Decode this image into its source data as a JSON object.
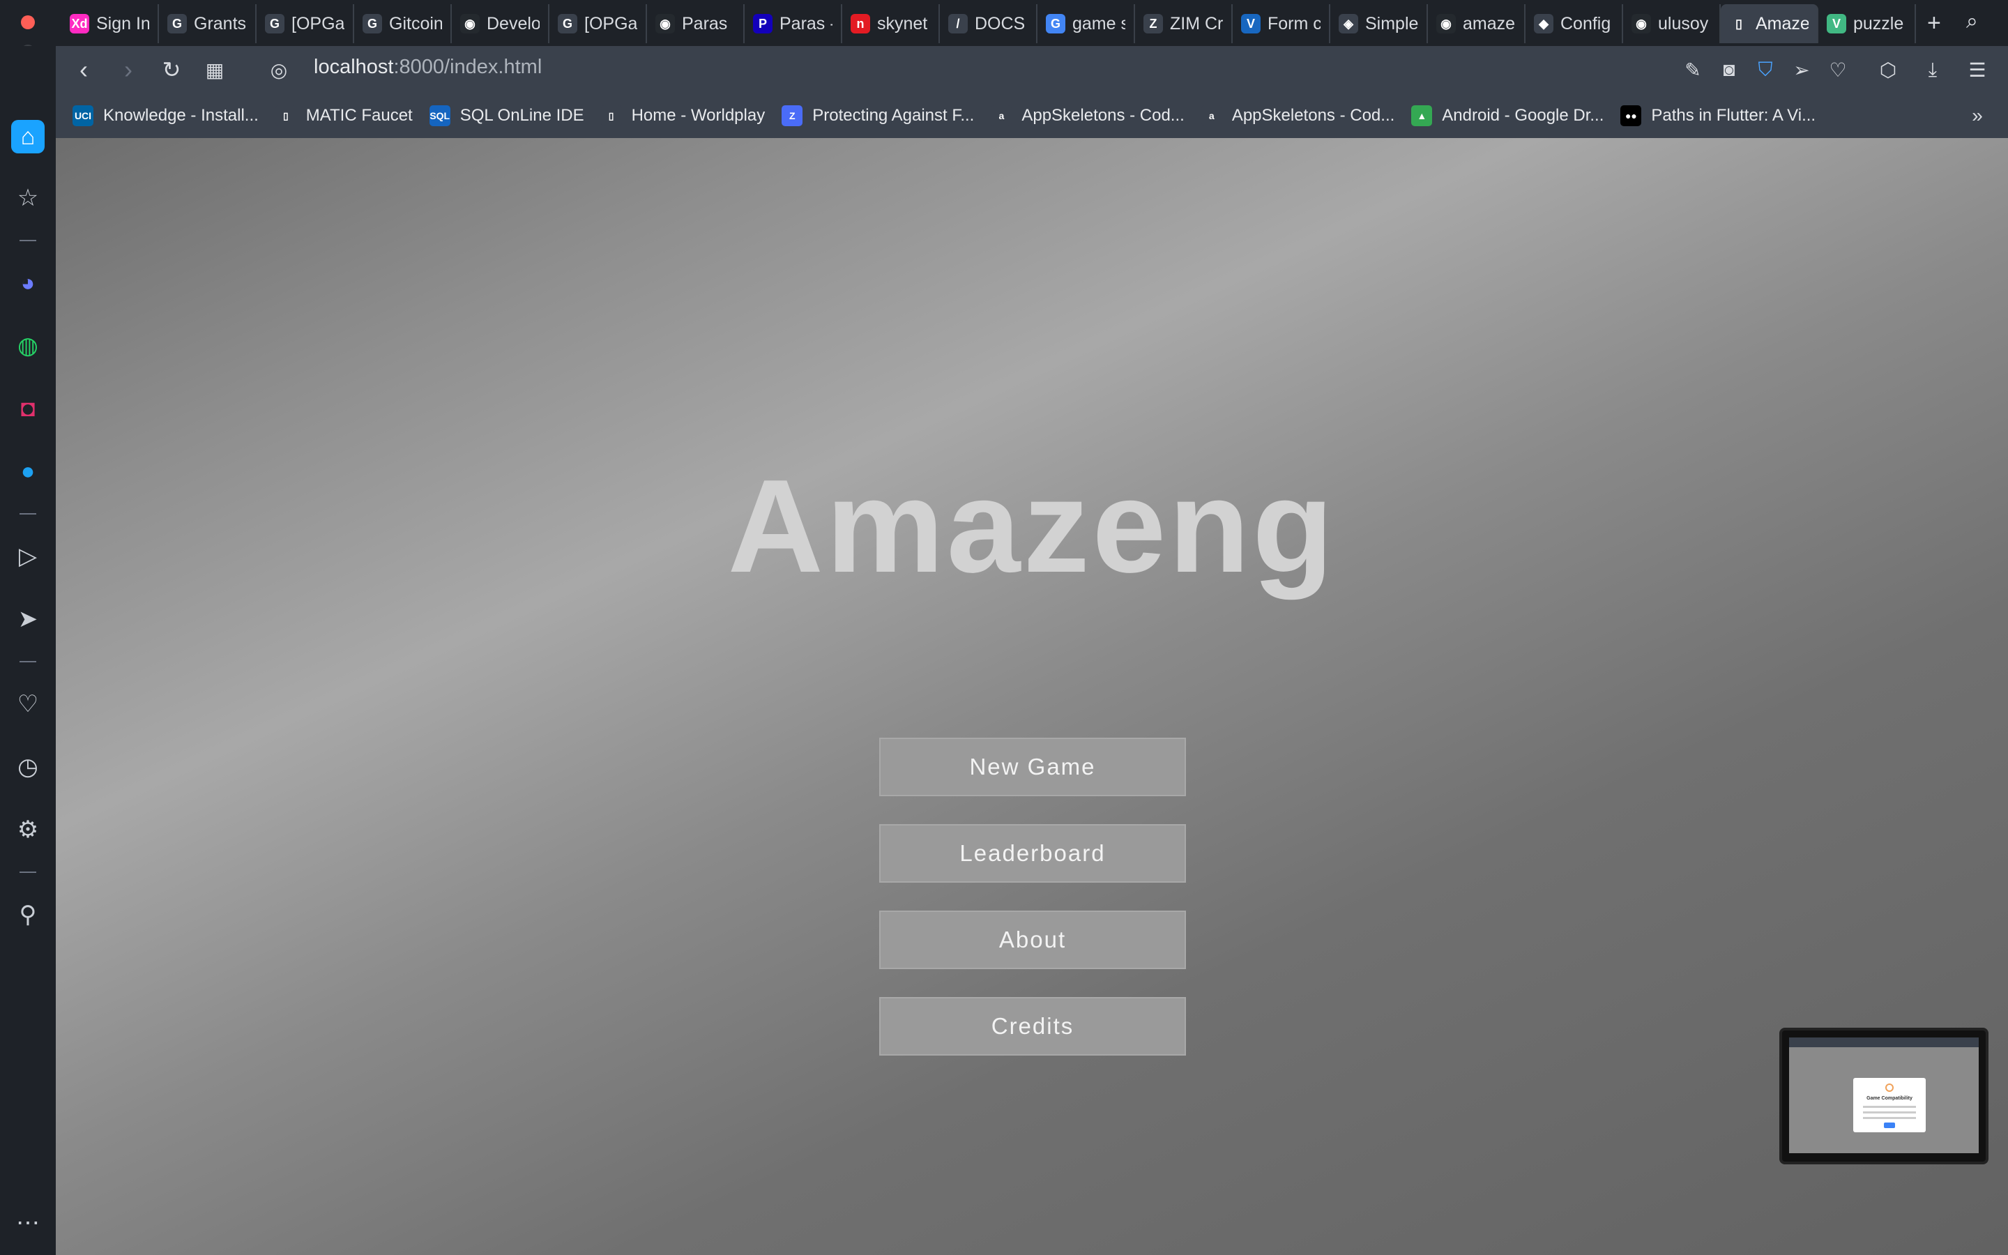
{
  "browser": {
    "tabs": [
      {
        "label": "Sign In",
        "icon": "xd-icon",
        "icon_text": "Xd",
        "color": "#ff2bc2"
      },
      {
        "label": "Grants",
        "icon": "gitcoin-icon",
        "icon_text": "G",
        "color": "#3a414c"
      },
      {
        "label": "[OPGa",
        "icon": "gitcoin-icon",
        "icon_text": "G",
        "color": "#3a414c"
      },
      {
        "label": "Gitcoin",
        "icon": "gitcoin-icon",
        "icon_text": "G",
        "color": "#3a414c"
      },
      {
        "label": "Develo",
        "icon": "github-icon",
        "icon_text": "◉",
        "color": "#24292e"
      },
      {
        "label": "[OPGa",
        "icon": "gitcoin-icon",
        "icon_text": "G",
        "color": "#3a414c"
      },
      {
        "label": "Paras",
        "icon": "github-icon",
        "icon_text": "◉",
        "color": "#24292e"
      },
      {
        "label": "Paras -",
        "icon": "paras-icon",
        "icon_text": "P",
        "color": "#1300ba"
      },
      {
        "label": "skynet",
        "icon": "skynet-icon",
        "icon_text": "n",
        "color": "#e31b23"
      },
      {
        "label": "DOCS",
        "icon": "docs-icon",
        "icon_text": "/",
        "color": "#3a414c"
      },
      {
        "label": "game s",
        "icon": "google-icon",
        "icon_text": "G",
        "color": "#4285f4"
      },
      {
        "label": "ZIM Cr",
        "icon": "zim-icon",
        "icon_text": "Z",
        "color": "#3a414c"
      },
      {
        "label": "Form c",
        "icon": "vuetify-icon",
        "icon_text": "V",
        "color": "#1867c0"
      },
      {
        "label": "Simple",
        "icon": "codepen-icon",
        "icon_text": "◈",
        "color": "#3a414c"
      },
      {
        "label": "amazer",
        "icon": "github-icon",
        "icon_text": "◉",
        "color": "#24292e"
      },
      {
        "label": "Config",
        "icon": "config-icon",
        "icon_text": "◆",
        "color": "#3a414c"
      },
      {
        "label": "ulusoy",
        "icon": "github-icon",
        "icon_text": "◉",
        "color": "#24292e"
      },
      {
        "label": "Amaze",
        "icon": "page-icon",
        "icon_text": "▯",
        "color": "#3a414c",
        "active": true
      },
      {
        "label": "puzzle",
        "icon": "vue-icon",
        "icon_text": "V",
        "color": "#41b883"
      }
    ],
    "url_host": "localhost",
    "url_path": ":8000/index.html",
    "bookmarks": [
      {
        "label": "Knowledge - Install...",
        "icon": "uci-icon",
        "icon_text": "UCI",
        "color": "#0064a4"
      },
      {
        "label": "MATIC Faucet",
        "icon": "page-icon",
        "icon_text": "▯",
        "color": "#3a414c"
      },
      {
        "label": "SQL OnLine IDE",
        "icon": "sql-icon",
        "icon_text": "SQL",
        "color": "#1565c0"
      },
      {
        "label": "Home - Worldplay",
        "icon": "page-icon",
        "icon_text": "▯",
        "color": "#3a414c"
      },
      {
        "label": "Protecting Against F...",
        "icon": "z-icon",
        "icon_text": "Z",
        "color": "#4a6cf7"
      },
      {
        "label": "AppSkeletons - Cod...",
        "icon": "a-icon",
        "icon_text": "a",
        "color": "#3a414c"
      },
      {
        "label": "AppSkeletons - Cod...",
        "icon": "a-icon",
        "icon_text": "a",
        "color": "#3a414c"
      },
      {
        "label": "Android - Google Dr...",
        "icon": "drive-icon",
        "icon_text": "▲",
        "color": "#34a853"
      },
      {
        "label": "Paths in Flutter: A Vi...",
        "icon": "medium-icon",
        "icon_text": "●●",
        "color": "#000000"
      }
    ]
  },
  "page": {
    "title": "Amazeng",
    "buttons": [
      {
        "label": "New Game"
      },
      {
        "label": "Leaderboard"
      },
      {
        "label": "About"
      },
      {
        "label": "Credits"
      }
    ]
  },
  "thumbnail": {
    "dialog_title": "Game Compatibility"
  }
}
